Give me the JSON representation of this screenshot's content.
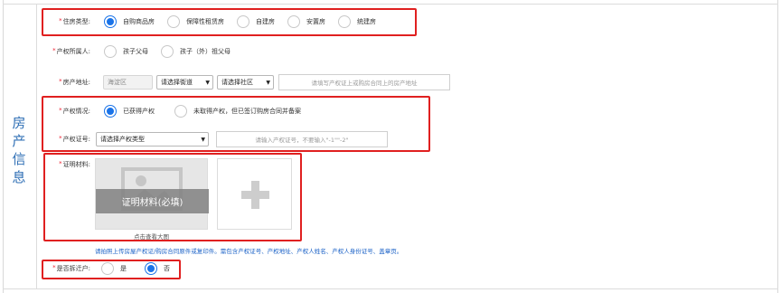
{
  "section": {
    "title_chars": [
      "房",
      "产",
      "信",
      "息"
    ]
  },
  "housing_type": {
    "label": "住房类型:",
    "options": [
      "自购商品房",
      "保障性租赁房",
      "自建房",
      "安置房",
      "统建房"
    ]
  },
  "owner": {
    "label": "产权所属人:",
    "options": [
      "孩子父母",
      "孩子（外）祖父母"
    ]
  },
  "address": {
    "label": "房产地址:",
    "district": "海淀区",
    "street": "请选择街道",
    "community": "请选择社区",
    "placeholder": "请填写产权证上或购房合同上的房产地址"
  },
  "property_status": {
    "label": "产权情况:",
    "options": [
      "已获得产权",
      "未取得产权，但已签订购房合同并备案"
    ]
  },
  "certificate": {
    "label": "产权证号:",
    "type_select": "请选择产权类型",
    "placeholder": "请输入产权证号，不要输入\"-1\"\"-2\""
  },
  "proof": {
    "label": "证明材料:",
    "upload_caption": "证明材料(必填)",
    "view_link": "点击查看大图",
    "note": "请拍照上传房屋产权证/购房合同原件或复印件。需包含产权证号、产权地址、产权人姓名、产权人身份证号、盖章页。"
  },
  "relocation": {
    "label": "是否拆迁户:",
    "options": [
      "是",
      "否"
    ]
  },
  "selection": {
    "housing_type": 0,
    "property_status": 0,
    "relocation": 1
  },
  "colors": {
    "accent": "#1a73e8",
    "highlight": "#e02020",
    "required": "#e22233",
    "section_title": "#2f6fb5"
  }
}
